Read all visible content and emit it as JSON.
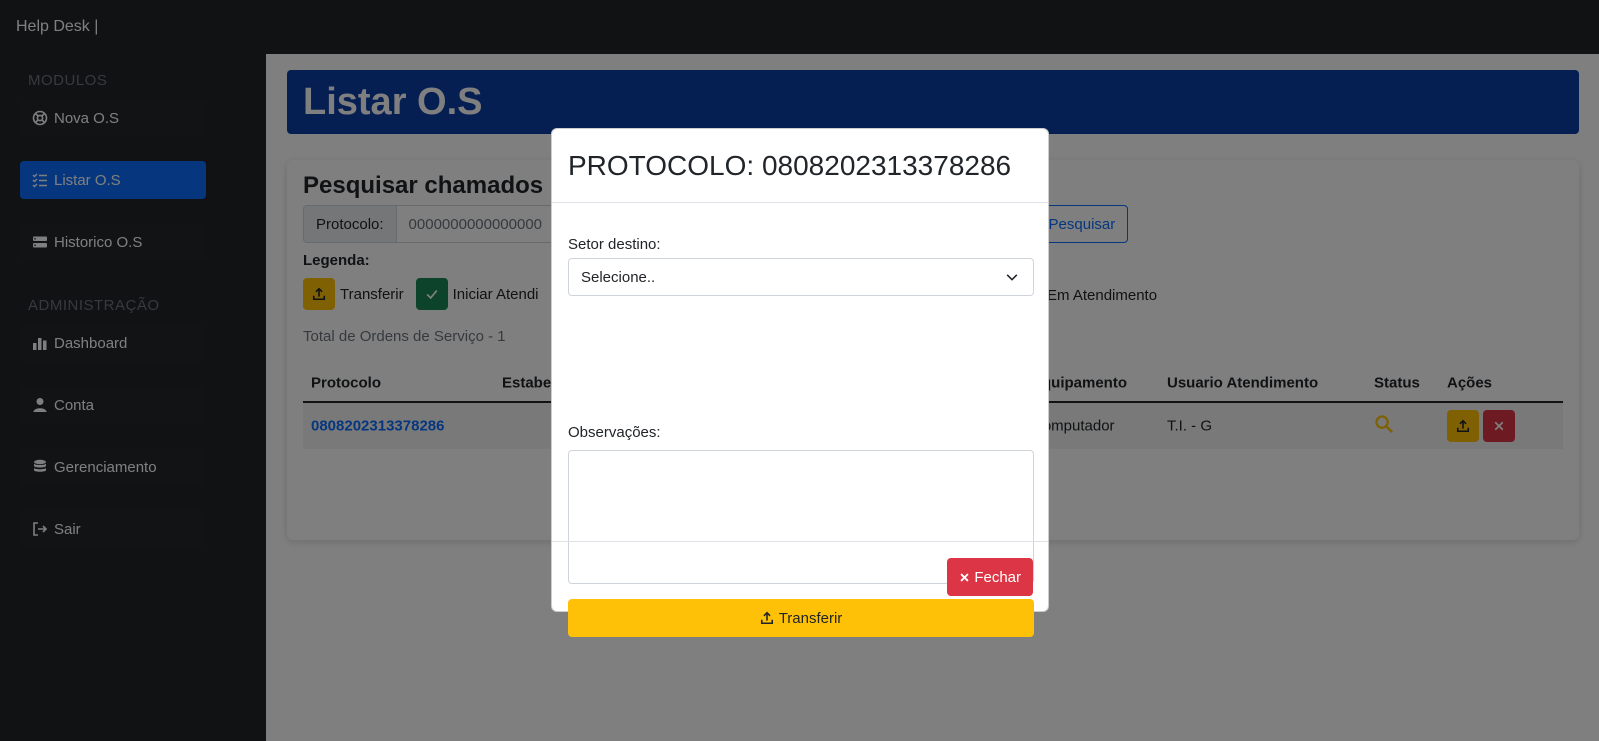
{
  "app": {
    "brand": "Help Desk |"
  },
  "sidebar": {
    "sections": [
      {
        "heading": "MODULOS"
      },
      {
        "heading": "ADMINISTRAÇÃO"
      }
    ],
    "items": [
      {
        "label": "Nova O.S",
        "icon": "support-icon"
      },
      {
        "label": "Listar O.S",
        "icon": "list-check-icon",
        "active": true
      },
      {
        "label": "Historico O.S",
        "icon": "server-icon"
      },
      {
        "label": "Dashboard",
        "icon": "bar-chart-icon"
      },
      {
        "label": "Conta",
        "icon": "person-icon"
      },
      {
        "label": "Gerenciamento",
        "icon": "database-icon"
      },
      {
        "label": "Sair",
        "icon": "logout-icon"
      }
    ]
  },
  "main": {
    "page_title": "Listar O.S",
    "search": {
      "title": "Pesquisar chamados po",
      "label": "Protocolo:",
      "placeholder": "0000000000000000",
      "button": "Pesquisar"
    },
    "legend": {
      "title": "Legenda:",
      "items": [
        {
          "label": "Transferir",
          "color": "#ffc107"
        },
        {
          "label": "Iniciar Atendi",
          "color": "#198754"
        }
      ],
      "in_progress": "Em Atendimento"
    },
    "total": "Total de Ordens de Serviço - 1",
    "table": {
      "headers": [
        "Protocolo",
        "Estabe",
        "Equipamento",
        "Usuario Atendimento",
        "Status",
        "Ações"
      ],
      "rows": [
        {
          "protocolo": "0808202313378286",
          "equipamento": "Computador",
          "usuario": "T.I. - G"
        }
      ]
    }
  },
  "modal": {
    "title": "PROTOCOLO: 0808202313378286",
    "setor_label": "Setor destino:",
    "select_value": "Selecione..",
    "obs_label": "Observações:",
    "transfer_button": "Transferir",
    "close_button": "Fechar"
  },
  "colors": {
    "primary": "#0d6efd",
    "warning": "#ffc107",
    "danger": "#dc3545",
    "success": "#198754",
    "dark": "#212529"
  }
}
